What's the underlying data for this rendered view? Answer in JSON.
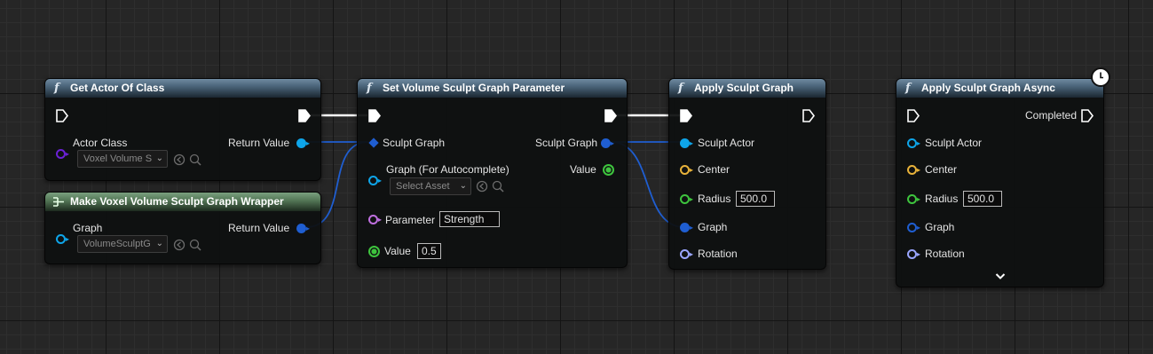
{
  "nodes": {
    "get_actor": {
      "title": "Get Actor Of Class",
      "actor_class_label": "Actor Class",
      "actor_class_value": "Voxel Volume S",
      "return_label": "Return Value"
    },
    "make_wrapper": {
      "title": "Make Voxel Volume Sculpt Graph Wrapper",
      "graph_label": "Graph",
      "graph_value": "VolumeSculptG",
      "return_label": "Return Value"
    },
    "set_param": {
      "title": "Set Volume Sculpt Graph Parameter",
      "sculpt_graph_in": "Sculpt Graph",
      "sculpt_graph_out": "Sculpt Graph",
      "graph_autocomplete_label": "Graph (For Autocomplete)",
      "select_asset": "Select Asset",
      "value_out": "Value",
      "parameter_label": "Parameter",
      "parameter_value": "Strength",
      "value_label": "Value",
      "value_value": "0.5"
    },
    "apply": {
      "title": "Apply Sculpt Graph",
      "sculpt_actor": "Sculpt Actor",
      "center": "Center",
      "radius": "Radius",
      "radius_value": "500.0",
      "graph": "Graph",
      "rotation": "Rotation"
    },
    "apply_async": {
      "title": "Apply Sculpt Graph Async",
      "completed": "Completed",
      "sculpt_actor": "Sculpt Actor",
      "center": "Center",
      "radius": "Radius",
      "radius_value": "500.0",
      "graph": "Graph",
      "rotation": "Rotation"
    }
  },
  "colors": {
    "object_pin": "#0ea5e9",
    "class_pin": "#6b21d6",
    "struct_pin": "#1f5ed1",
    "vector_pin": "#e8b23a",
    "float_pin": "#3ec43e",
    "name_pin": "#c070e0",
    "rotator_pin": "#9aa6ff",
    "exec_wire": "#ffffff"
  },
  "icons": [
    "function-icon",
    "make-struct-icon",
    "latent-clock-icon",
    "exec-pin-icon",
    "browse-icon",
    "search-icon",
    "chevron-down-icon"
  ]
}
